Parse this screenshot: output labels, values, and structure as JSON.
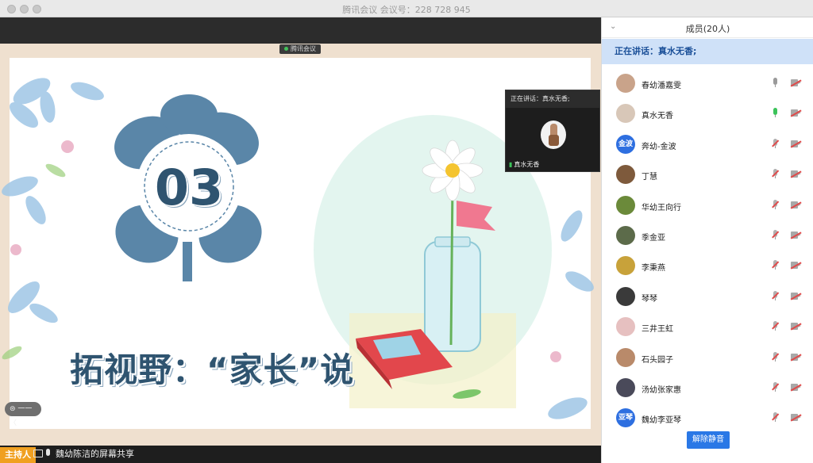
{
  "window": {
    "title": "腾讯会议 会议号：228 728 945"
  },
  "stage": {
    "meeting_tag": "腾讯会议",
    "slide_number": "03",
    "slide_heading": "拓视野：“家长”说",
    "hand_badge": "⊜ 一一 〈"
  },
  "speaker_tile": {
    "header": "正在讲话：真水无香;",
    "name": "真水无香"
  },
  "bottom_bar": {
    "host_label": "主持人",
    "share_text": "魏幼陈洁的屏幕共享"
  },
  "panel": {
    "title": "成员(20人)",
    "speaking": "正在讲话：真水无香;",
    "unmute_label": "解除静音",
    "members": [
      {
        "name": "春幼潘嘉雯",
        "avatar": "photo",
        "avatar_color": "#c9a38a",
        "mic": "on-grey",
        "cam": "off"
      },
      {
        "name": "真水无香",
        "avatar": "photo",
        "avatar_color": "#d8c7b8",
        "mic": "on-green",
        "cam": "off"
      },
      {
        "name": "奔幼-金波",
        "avatar": "text",
        "avatar_text": "金波",
        "avatar_color": "#2e6fe0",
        "mic": "off",
        "cam": "off"
      },
      {
        "name": "丁慧",
        "avatar": "photo",
        "avatar_color": "#7e5a3c",
        "mic": "off",
        "cam": "off"
      },
      {
        "name": "华幼王向行",
        "avatar": "photo",
        "avatar_color": "#6b8a3a",
        "mic": "off",
        "cam": "off"
      },
      {
        "name": "季金亚",
        "avatar": "photo",
        "avatar_color": "#5c6b4a",
        "mic": "off",
        "cam": "off"
      },
      {
        "name": "李秉燕",
        "avatar": "photo",
        "avatar_color": "#c8a23a",
        "mic": "off",
        "cam": "off"
      },
      {
        "name": "琴琴",
        "avatar": "photo",
        "avatar_color": "#3a3a3a",
        "mic": "off",
        "cam": "off"
      },
      {
        "name": "三井王虹",
        "avatar": "photo",
        "avatar_color": "#e6c0c0",
        "mic": "off",
        "cam": "off"
      },
      {
        "name": "石头园子",
        "avatar": "photo",
        "avatar_color": "#b98a6a",
        "mic": "off",
        "cam": "off"
      },
      {
        "name": "汤幼张家惠",
        "avatar": "photo",
        "avatar_color": "#4a4a5a",
        "mic": "off",
        "cam": "off"
      },
      {
        "name": "魏幼李亚琴",
        "avatar": "text",
        "avatar_text": "亚琴",
        "avatar_color": "#2e6fe0",
        "mic": "off",
        "cam": "off"
      }
    ]
  },
  "colors": {
    "accent_blue": "#2a78e6",
    "speaking_bg": "#cfe1f8",
    "host_orange": "#f0a020",
    "muted_red": "#e04b4b",
    "mic_green": "#3cc35a",
    "slide_blue": "#2f5470"
  }
}
